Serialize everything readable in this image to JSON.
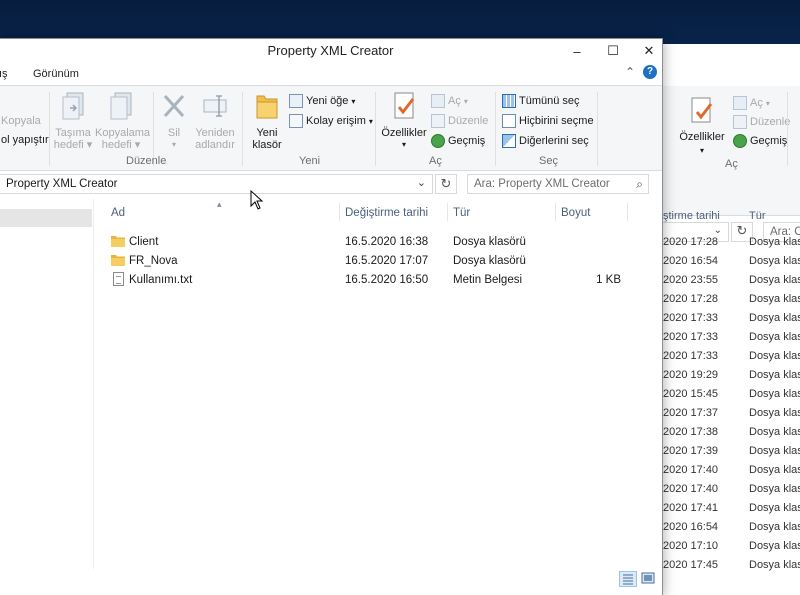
{
  "window": {
    "title": "Property XML Creator",
    "controls": {
      "minimize": "–",
      "maximize": "☐",
      "close": "✕"
    }
  },
  "tabs": {
    "partial_left": "ış",
    "view": "Görünüm"
  },
  "ribbon": {
    "clipboard_partial": {
      "copy": "Kopyala",
      "paste_shortcut": "ol yapıştır"
    },
    "organize": {
      "move_to": [
        "Taşıma",
        "hedefi"
      ],
      "copy_to": [
        "Kopyalama",
        "hedefi"
      ],
      "delete": "Sil",
      "rename": [
        "Yeniden",
        "adlandır"
      ],
      "label": "Düzenle"
    },
    "new": {
      "new_folder": [
        "Yeni",
        "klasör"
      ],
      "new_item": "Yeni öğe",
      "easy_access": "Kolay erişim",
      "label": "Yeni"
    },
    "open": {
      "properties": "Özellikler",
      "open": "Aç",
      "edit": "Düzenle",
      "history": "Geçmiş",
      "label": "Aç"
    },
    "select": {
      "select_all": "Tümünü seç",
      "select_none": "Hiçbirini seçme",
      "invert": "Diğerlerini seç",
      "label": "Seç"
    }
  },
  "address": {
    "path": "Property XML Creator",
    "search_placeholder": "Ara: Property XML Creator"
  },
  "columns": {
    "name": "Ad",
    "modified": "Değiştirme tarihi",
    "type": "Tür",
    "size": "Boyut"
  },
  "files": [
    {
      "name": "Client",
      "modified": "16.5.2020 16:38",
      "type": "Dosya klasörü",
      "size": "",
      "icon": "folder-icon"
    },
    {
      "name": "FR_Nova",
      "modified": "16.5.2020 17:07",
      "type": "Dosya klasörü",
      "size": "",
      "icon": "folder-icon"
    },
    {
      "name": "Kullanımı.txt",
      "modified": "16.5.2020 16:50",
      "type": "Metin Belgesi",
      "size": "1 KB",
      "icon": "text-file-icon"
    }
  ],
  "background_window": {
    "ribbon": {
      "properties": "Özellikler",
      "open": "Aç",
      "edit": "Düzenle",
      "history": "Geçmiş",
      "group_label": "Aç"
    },
    "search_partial": "Ara: Cl",
    "columns": {
      "modified_partial": "ştirme tarihi",
      "type": "Tür"
    },
    "dates": [
      "2020 17:28",
      "2020 16:54",
      "2020 23:55",
      "2020 17:28",
      "2020 17:33",
      "2020 17:33",
      "2020 17:33",
      "2020 19:29",
      "2020 15:45",
      "2020 17:37",
      "2020 17:38",
      "2020 17:39",
      "2020 17:40",
      "2020 17:40",
      "2020 17:41",
      "2020 16:54",
      "2020 17:10",
      "2020 17:45"
    ],
    "type_partial": "Dosya klas"
  }
}
